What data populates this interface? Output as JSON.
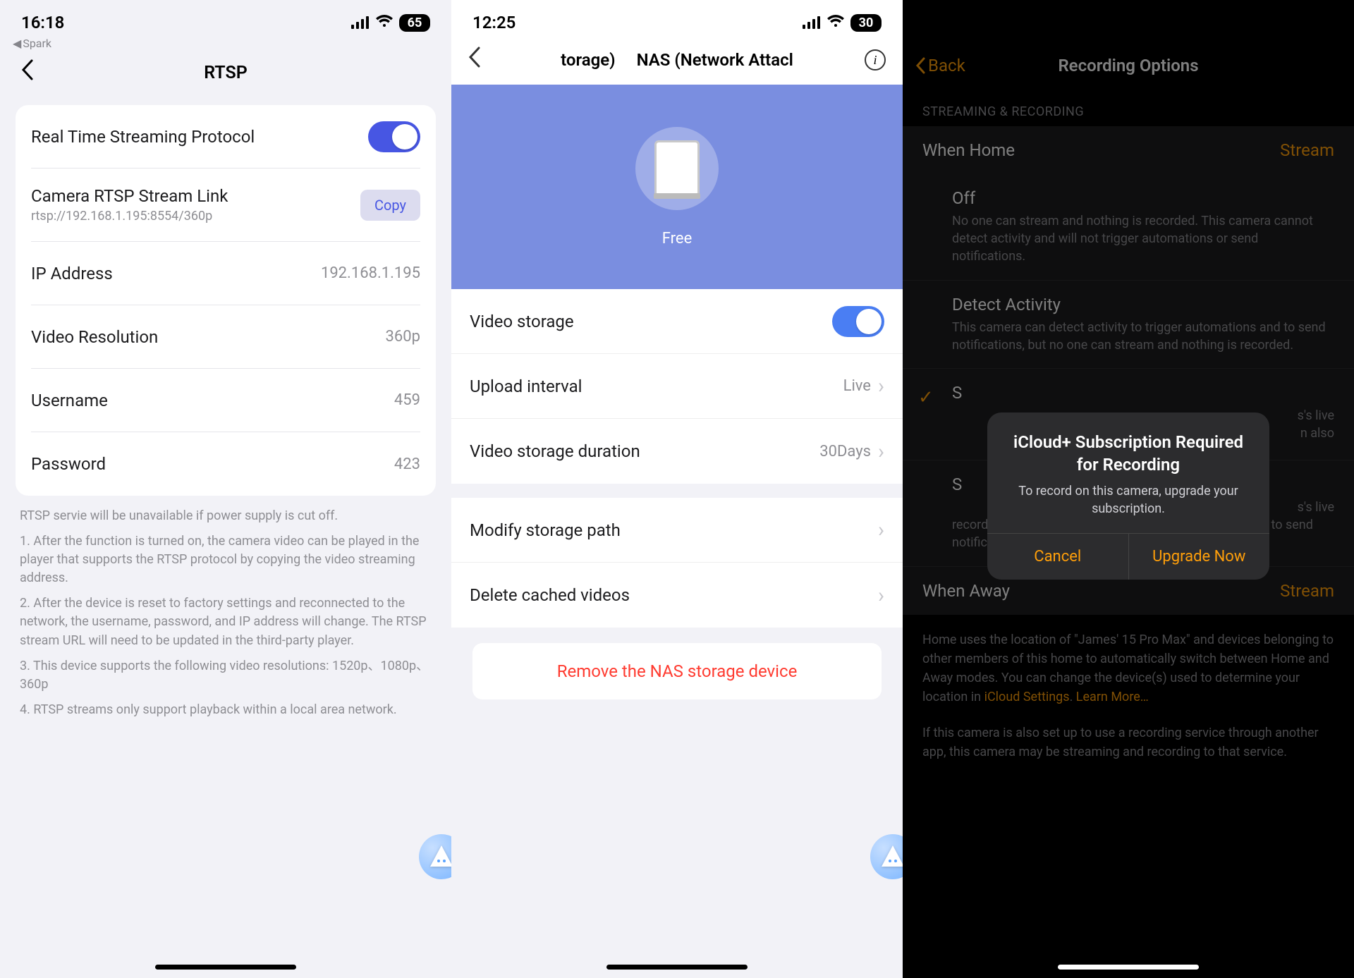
{
  "screen1": {
    "status": {
      "time": "16:18",
      "battery": "65",
      "back_app": "Spark"
    },
    "title": "RTSP",
    "rows": {
      "rtsp_label": "Real Time Streaming Protocol",
      "link_label": "Camera RTSP Stream Link",
      "link_value": "rtsp://192.168.1.195:8554/360p",
      "copy": "Copy",
      "ip_label": "IP Address",
      "ip_value": "192.168.1.195",
      "res_label": "Video Resolution",
      "res_value": "360p",
      "user_label": "Username",
      "user_value": "459",
      "pass_label": "Password",
      "pass_value": "423"
    },
    "notes": {
      "n0": "RTSP servie will be unavailable if power supply is cut off.",
      "n1": "1. After the function is turned on, the camera video can be played in the player that supports the RTSP protocol by copying the video streaming address.",
      "n2": "2. After the device is reset to factory settings and reconnected to the network, the username, password, and IP address will change. The RTSP stream URL will need to be updated in the third-party player.",
      "n3": "3. This device supports the following video resolutions: 1520p、1080p、360p",
      "n4": "4. RTSP streams only support playback within a local area network."
    }
  },
  "screen2": {
    "status": {
      "time": "12:25",
      "battery": "30"
    },
    "nav": {
      "title_left": "torage)",
      "title_right": "NAS (Network Attacl"
    },
    "hero_plan": "Free",
    "rows": {
      "storage_label": "Video storage",
      "interval_label": "Upload interval",
      "interval_value": "Live",
      "duration_label": "Video storage duration",
      "duration_value": "30Days",
      "path_label": "Modify storage path",
      "delete_label": "Delete cached videos"
    },
    "remove": "Remove the NAS storage device"
  },
  "screen3": {
    "nav": {
      "back": "Back",
      "title": "Recording Options"
    },
    "section": "STREAMING & RECORDING",
    "when_home": {
      "label": "When Home",
      "value": "Stream"
    },
    "options": {
      "off_title": "Off",
      "off_desc": "No one can stream and nothing is recorded. This camera cannot detect activity and will not trigger automations or send notifications.",
      "detect_title": "Detect Activity",
      "detect_desc": "This camera can detect activity to trigger automations and to send notifications, but no one can stream and nothing is recorded.",
      "stream_partial1": "s's live",
      "stream_partial2": "n also",
      "rec_partial1": "s's live",
      "rec_desc_tail": "recorded and can also be used to trigger automations or to send notifications."
    },
    "when_away": {
      "label": "When Away",
      "value": "Stream"
    },
    "footer": {
      "p1a": "Home uses the location of \"James' 15 Pro Max\" and devices belonging to other members of this home to automatically switch between Home and Away modes. You can change the device(s) used to determine your location in ",
      "p1link": "iCloud Settings",
      "p1b": ". ",
      "p1learn": "Learn More…",
      "p2": "If this camera is also set up to use a recording service through another app, this camera may be streaming and recording to that service."
    },
    "alert": {
      "title": "iCloud+ Subscription Required for Recording",
      "msg": "To record on this camera, upgrade your subscription.",
      "cancel": "Cancel",
      "upgrade": "Upgrade Now"
    }
  }
}
